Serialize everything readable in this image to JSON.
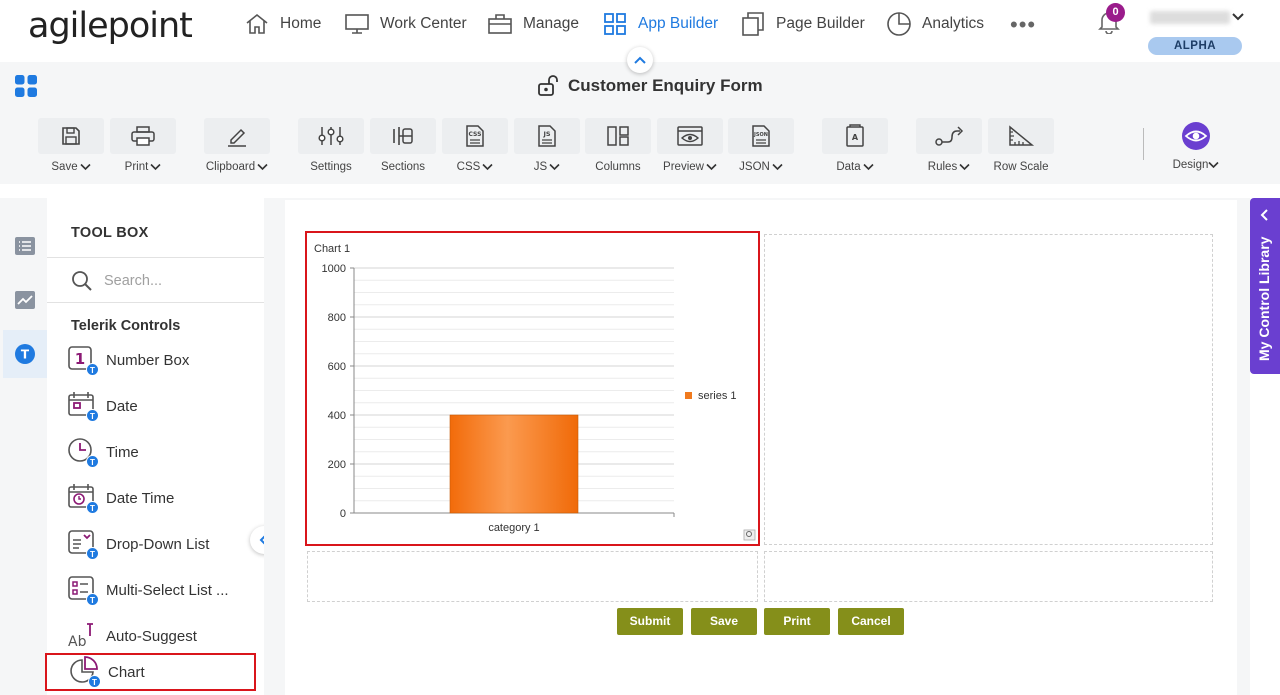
{
  "app": {
    "logo": "agilepoint",
    "notification_count": "0",
    "environment_badge": "ALPHA"
  },
  "nav": {
    "items": [
      {
        "label": "Home",
        "icon": "home-icon"
      },
      {
        "label": "Work Center",
        "icon": "monitor-icon"
      },
      {
        "label": "Manage",
        "icon": "briefcase-icon"
      },
      {
        "label": "App Builder",
        "icon": "grid-icon",
        "active": true
      },
      {
        "label": "Page Builder",
        "icon": "pages-icon"
      },
      {
        "label": "Analytics",
        "icon": "pie-chart-icon"
      }
    ]
  },
  "form": {
    "title": "Customer Enquiry Form"
  },
  "toolbar": {
    "save": "Save",
    "print": "Print",
    "clipboard": "Clipboard",
    "settings": "Settings",
    "sections": "Sections",
    "css": "CSS",
    "js": "JS",
    "columns": "Columns",
    "preview": "Preview",
    "json": "JSON",
    "data": "Data",
    "rules": "Rules",
    "row_scale": "Row Scale",
    "design": "Design"
  },
  "toolbox": {
    "title": "TOOL BOX",
    "search_placeholder": "Search...",
    "section": "Telerik Controls",
    "items": [
      {
        "label": "Number Box",
        "icon": "number-box-icon"
      },
      {
        "label": "Date",
        "icon": "date-icon"
      },
      {
        "label": "Time",
        "icon": "time-icon"
      },
      {
        "label": "Date Time",
        "icon": "date-time-icon"
      },
      {
        "label": "Drop-Down List",
        "icon": "dropdown-list-icon"
      },
      {
        "label": "Multi-Select List ...",
        "icon": "multi-select-list-icon"
      },
      {
        "label": "Auto-Suggest",
        "icon": "auto-suggest-icon"
      },
      {
        "label": "Chart",
        "icon": "chart-icon"
      }
    ]
  },
  "right_panel": {
    "label": "My Control Library"
  },
  "buttons": {
    "submit": "Submit",
    "save": "Save",
    "print": "Print",
    "cancel": "Cancel"
  },
  "colors": {
    "accent": "#1f7ae0",
    "highlight": "#d9151b",
    "form_button": "#858f1a",
    "library_tab": "#6a3fd0",
    "bar": "#f07a1e"
  },
  "chart_data": {
    "type": "bar",
    "title": "Chart 1",
    "categories": [
      "category 1"
    ],
    "series": [
      {
        "name": "series 1",
        "values": [
          400
        ]
      }
    ],
    "ylim": [
      0,
      1000
    ],
    "yticks": [
      0,
      200,
      400,
      600,
      800,
      1000
    ],
    "grid": true,
    "legend": "right"
  }
}
